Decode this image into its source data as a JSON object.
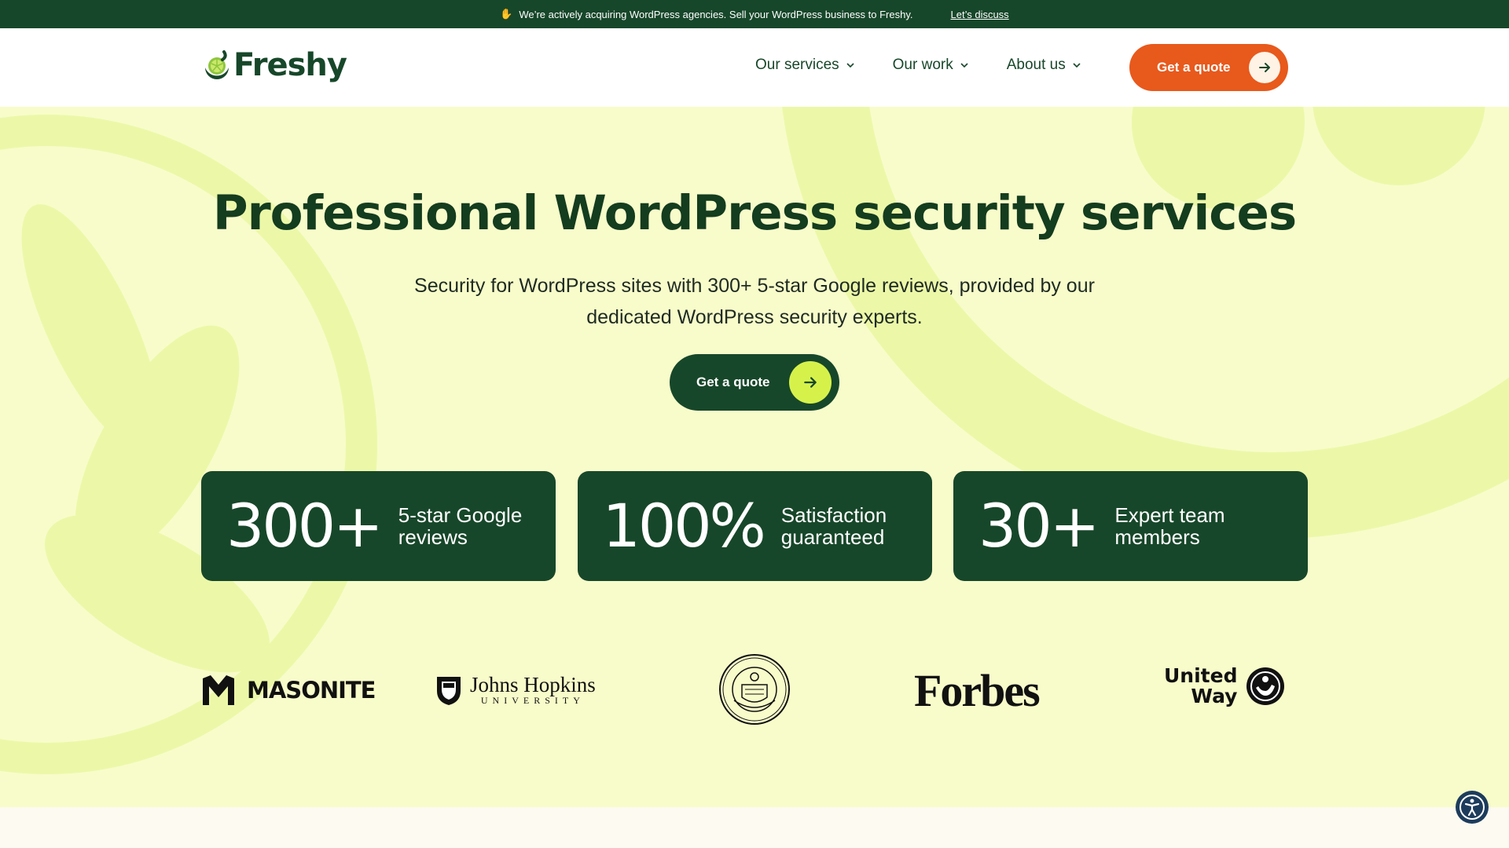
{
  "announcement": {
    "text": "We’re actively acquiring WordPress agencies. Sell your WordPress business to Freshy.",
    "link": "Let’s discuss"
  },
  "header": {
    "logo_text": "Freshy",
    "nav": [
      {
        "label": "Our services"
      },
      {
        "label": "Our work"
      },
      {
        "label": "About us"
      }
    ],
    "cta_label": "Get a quote"
  },
  "hero": {
    "title": "Professional WordPress security services",
    "subtitle_line1": "Security for WordPress sites with 300+ 5-star Google reviews, provided by our",
    "subtitle_line2": "dedicated WordPress security experts.",
    "cta_label": "Get a quote"
  },
  "stats": [
    {
      "value": "300+",
      "label": "5-star Google reviews"
    },
    {
      "value": "100%",
      "label": "Satisfaction guaranteed"
    },
    {
      "value": "30+",
      "label": "Expert team members"
    }
  ],
  "clients": {
    "masonite": "MASONITE",
    "jhu_line1": "Johns Hopkins",
    "jhu_line2": "UNIVERSITY",
    "forbes": "Forbes",
    "uw_line1": "United",
    "uw_line2": "Way"
  },
  "colors": {
    "dark_green": "#17472a",
    "lime": "#d6f24a",
    "orange": "#e8591c",
    "hero_bg": "#f8fcca"
  },
  "icons": [
    "handshake-icon",
    "chevron-down-icon",
    "arrow-right-icon",
    "accessibility-icon"
  ]
}
